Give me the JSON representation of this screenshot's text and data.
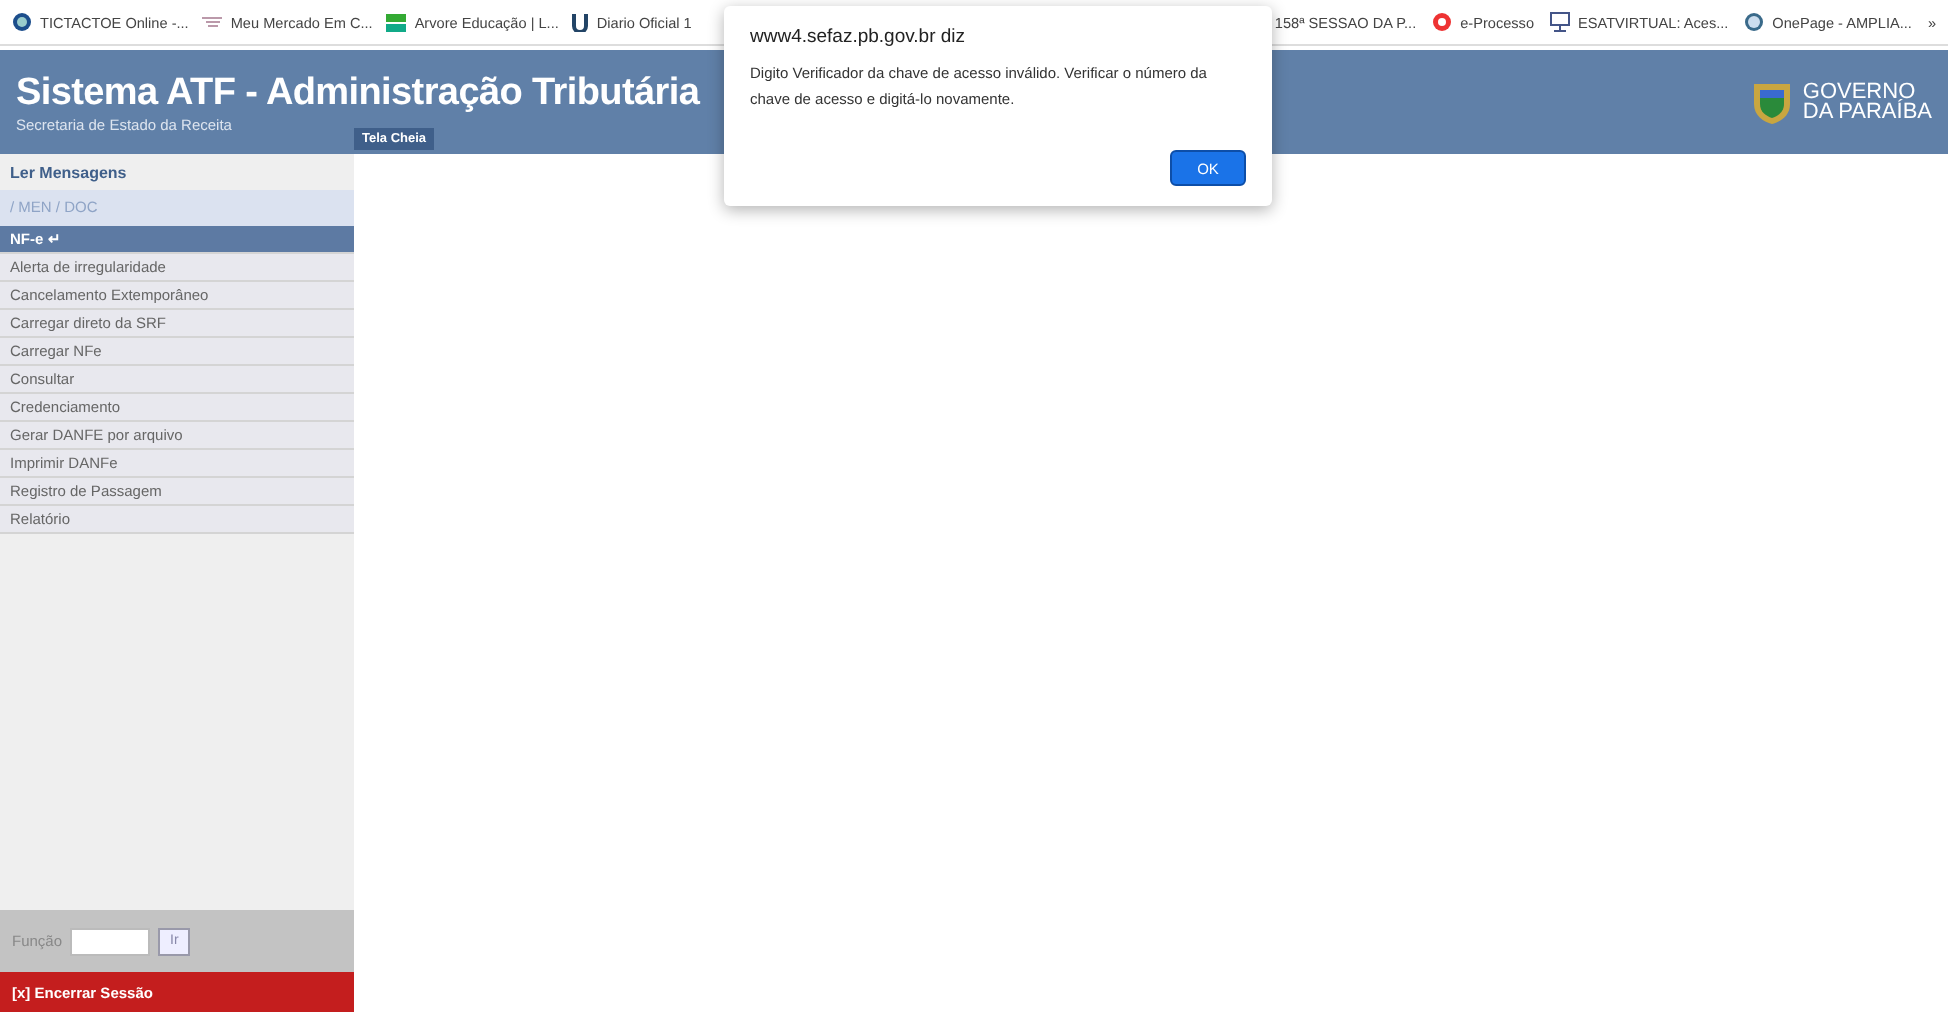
{
  "bookmarks_left": [
    {
      "label": "TICTACTOE Online -...",
      "kind": "globe"
    },
    {
      "label": "Meu Mercado Em C...",
      "kind": "cart"
    },
    {
      "label": "Arvore Educação | L...",
      "kind": "tree"
    },
    {
      "label": "Diario Oficial 1",
      "kind": "u"
    }
  ],
  "bookmarks_right": [
    {
      "label": "158ª SESSAO DA P...",
      "kind": "none"
    },
    {
      "label": "e-Processo",
      "kind": "target"
    },
    {
      "label": "ESATVIRTUAL: Aces...",
      "kind": "monitor"
    },
    {
      "label": "OnePage - AMPLIA...",
      "kind": "wp"
    }
  ],
  "bookmarks_more": "»",
  "header": {
    "title": "Sistema ATF - Administração Tributária",
    "subtitle": "Secretaria de Estado da Receita",
    "fullscreen_button": "Tela Cheia",
    "logo_line1": "GOVERNO",
    "logo_line2": "DA PARAÍBA"
  },
  "sidebar": {
    "messages_link": "Ler Mensagens",
    "breadcrumb": "/ MEN / DOC",
    "items": [
      {
        "label": "NF-e ↵",
        "selected": true
      },
      {
        "label": "Alerta de irregularidade",
        "selected": false
      },
      {
        "label": "Cancelamento Extemporâneo",
        "selected": false
      },
      {
        "label": "Carregar direto da SRF",
        "selected": false
      },
      {
        "label": "Carregar NFe",
        "selected": false
      },
      {
        "label": "Consultar",
        "selected": false
      },
      {
        "label": "Credenciamento",
        "selected": false
      },
      {
        "label": "Gerar DANFE por arquivo",
        "selected": false
      },
      {
        "label": "Imprimir DANFe",
        "selected": false
      },
      {
        "label": "Registro de Passagem",
        "selected": false
      },
      {
        "label": "Relatório",
        "selected": false
      }
    ],
    "function_label": "Função",
    "go_button": "Ir",
    "logout": "[x] Encerrar Sessão"
  },
  "dialog": {
    "title": "www4.sefaz.pb.gov.br diz",
    "message": "Digito Verificador da chave de acesso inválido. Verificar o número da chave de acesso e digitá-lo novamente.",
    "ok_button": "OK"
  }
}
